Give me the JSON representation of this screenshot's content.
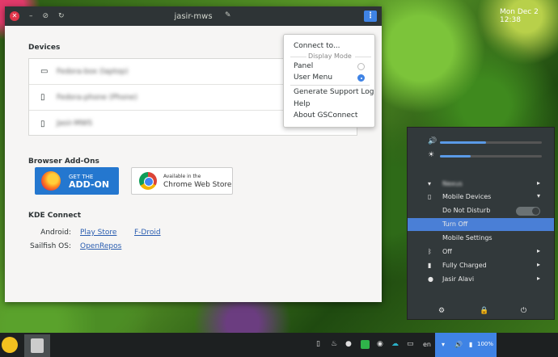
{
  "window": {
    "title": "jasir-mws",
    "close_glyph": "✕",
    "minimize_glyph": "–",
    "refresh_glyph": "↻",
    "menu_glyph": "⋮",
    "edit_glyph": "✎"
  },
  "devices": {
    "title": "Devices",
    "items": [
      {
        "icon": "monitor-icon",
        "glyph": "▭",
        "name": "Fedora-box (laptop)"
      },
      {
        "icon": "phone-icon",
        "glyph": "▯",
        "name": "Fedora-phone (Phone)"
      },
      {
        "icon": "tablet-icon",
        "glyph": "▯",
        "name": "Jasir-MWS"
      }
    ]
  },
  "addons": {
    "title": "Browser Add-Ons",
    "firefox": {
      "line1": "GET THE",
      "line2": "ADD-ON"
    },
    "chrome": {
      "line1": "Available in the",
      "line2": "Chrome Web Store"
    }
  },
  "kde": {
    "title": "KDE Connect",
    "android_label": "Android:",
    "play_store": "Play Store",
    "fdroid": "F-Droid",
    "sailfish_label": "Sailfish OS:",
    "openrepos": "OpenRepos"
  },
  "popup": {
    "connect": "Connect to...",
    "display_mode": "Display Mode",
    "panel": "Panel",
    "user_menu": "User Menu",
    "support_log": "Generate Support Log",
    "help": "Help",
    "about": "About GSConnect"
  },
  "sysmenu": {
    "volume_level": 0.45,
    "brightness_level": 0.3,
    "wifi": "Nexus",
    "mobile_devices": "Mobile Devices",
    "dnd": "Do Not Disturb",
    "turn_off": "Turn Off",
    "mobile_settings": "Mobile Settings",
    "bluetooth": "Off",
    "battery": "Fully Charged",
    "user": "Jasir Alavi"
  },
  "taskbar": {
    "lang": "en",
    "battery": "100%",
    "clock": "Mon Dec 2  12:38"
  },
  "colors": {
    "accent": "#3f83e5",
    "titlebar": "#2e3436",
    "close": "#e0364a",
    "sys_bg": "#32393b"
  }
}
